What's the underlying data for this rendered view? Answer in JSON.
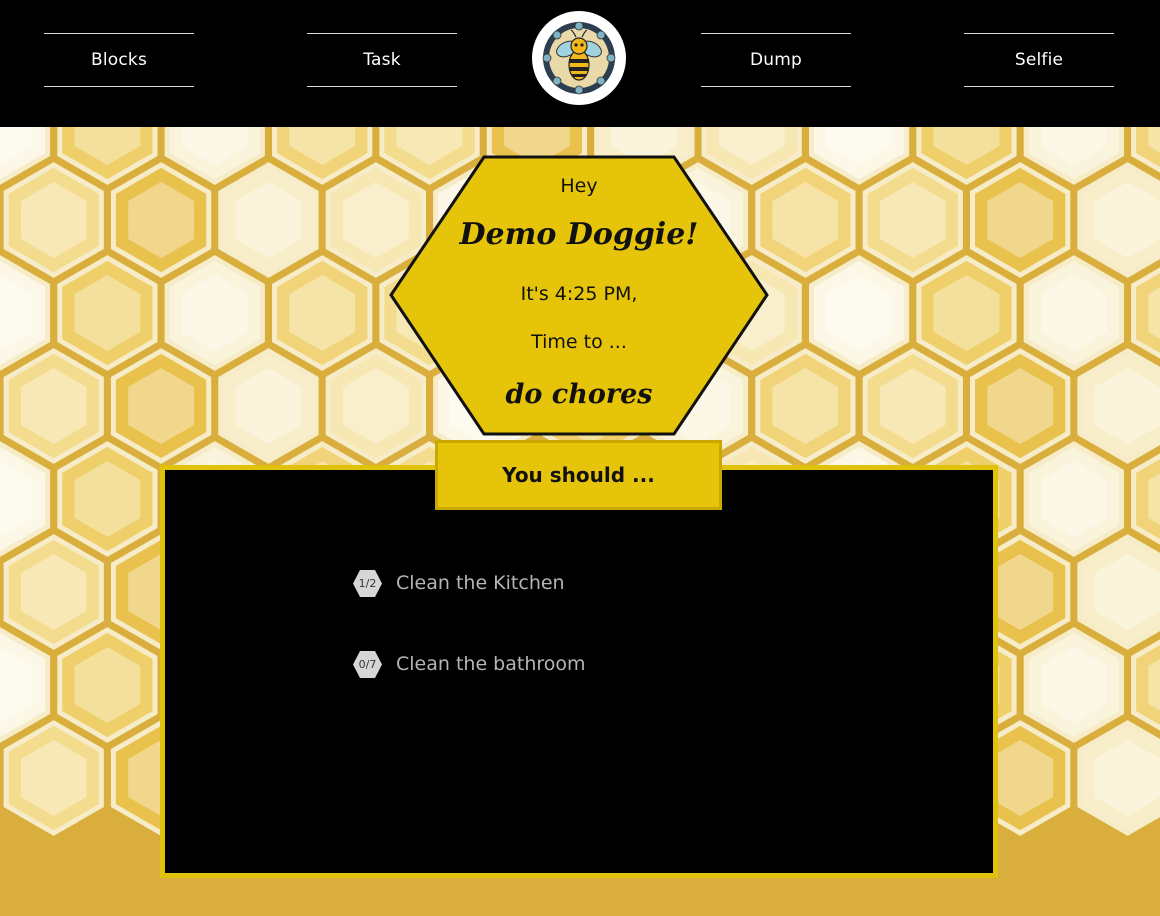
{
  "nav": {
    "items": [
      {
        "label": "Blocks"
      },
      {
        "label": "Task"
      },
      {
        "label": "Dump"
      },
      {
        "label": "Selfie"
      }
    ],
    "logo_icon": "bee-icon"
  },
  "greeting": {
    "hey": "Hey",
    "name": "Demo Doggie!",
    "time": "It's 4:25 PM,",
    "time_to": "Time to ...",
    "activity": "do chores"
  },
  "panel": {
    "title": "You should ...",
    "tasks": [
      {
        "progress": "1/2",
        "label": "Clean the Kitchen"
      },
      {
        "progress": "0/7",
        "label": "Clean the bathroom"
      }
    ]
  },
  "colors": {
    "accent_yellow": "#e6c40a",
    "nav_background": "#000000",
    "panel_background": "#000000",
    "task_text": "#b5b5b5"
  }
}
